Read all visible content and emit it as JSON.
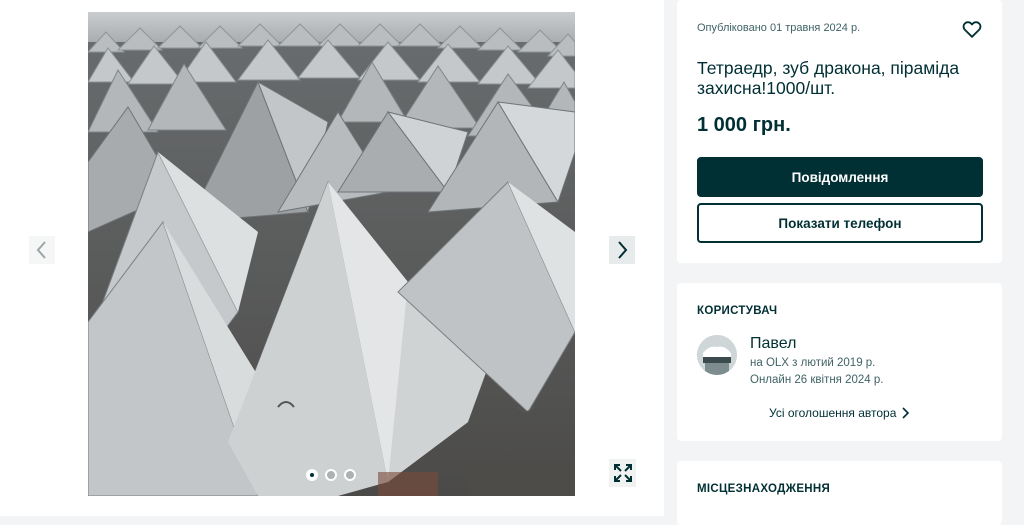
{
  "gallery": {
    "image_alt": "Concrete tetrahedron anti-tank pyramids",
    "icons": {
      "prev": "chevron-left-icon",
      "next": "chevron-right-icon",
      "expand": "expand-icon"
    },
    "dots_count": 3,
    "active_dot": 1
  },
  "listing": {
    "published": "Опубліковано 01 травня 2024 р.",
    "title": "Тетраедр, зуб дракона, піраміда захисна!1000/шт.",
    "price": "1 000 грн.",
    "message_button": "Повідомлення",
    "phone_button": "Показати телефон",
    "favorite_icon": "heart-icon"
  },
  "user": {
    "section_title": "КОРИСТУВАЧ",
    "name": "Павел",
    "since": "на OLX з лютий 2019 р.",
    "online": "Онлайн 26 квітня 2024 р.",
    "all_ads": "Усі оголошення автора"
  },
  "location": {
    "section_title": "МІСЦЕЗНАХОДЖЕННЯ"
  },
  "colors": {
    "brand_dark": "#002f34",
    "page_bg": "#f2f4f5",
    "muted_text": "#406367"
  }
}
